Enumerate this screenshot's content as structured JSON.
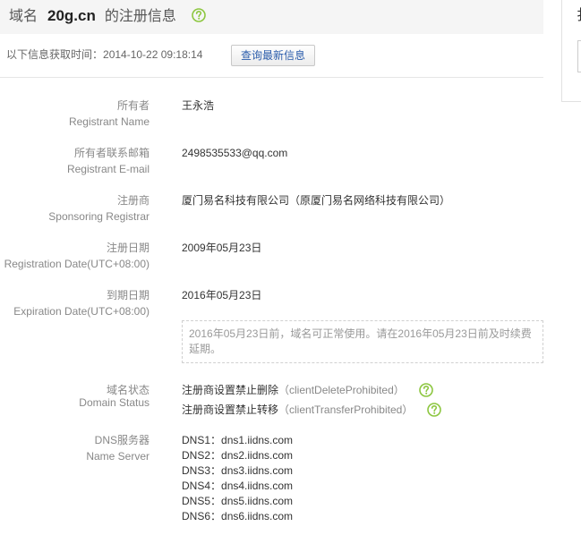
{
  "header": {
    "prefix": "域名",
    "domain": "20g.cn",
    "suffix": "的注册信息",
    "help_icon": "question-circle-icon"
  },
  "fetch_info": {
    "label": "以下信息获取时间：",
    "time": "2014-10-22 09:18:14",
    "refresh_button": "查询最新信息"
  },
  "side_panel": {
    "partial_glyph": "扌"
  },
  "registrant_name": {
    "label_cn": "所有者",
    "label_en": "Registrant Name",
    "value": "王永浩"
  },
  "registrant_email": {
    "label_cn": "所有者联系邮箱",
    "label_en": "Registrant E-mail",
    "value": "2498535533@qq.com"
  },
  "registrar": {
    "label_cn": "注册商",
    "label_en": "Sponsoring Registrar",
    "value": "厦门易名科技有限公司（原厦门易名网络科技有限公司）"
  },
  "registration_date": {
    "label_cn": "注册日期",
    "label_en": "Registration Date(UTC+08:00)",
    "value": "2009年05月23日"
  },
  "expiration_date": {
    "label_cn": "到期日期",
    "label_en": "Expiration Date(UTC+08:00)",
    "value": "2016年05月23日",
    "notice": "2016年05月23日前，域名可正常使用。请在2016年05月23日前及时续费延期。"
  },
  "domain_status": {
    "label_cn": "域名状态",
    "label_en": "Domain Status",
    "items": [
      {
        "text": "注册商设置禁止删除",
        "code": "（clientDeleteProhibited）",
        "help_icon": "question-circle-icon"
      },
      {
        "text": "注册商设置禁止转移",
        "code": "（clientTransferProhibited）",
        "help_icon": "question-circle-icon"
      }
    ]
  },
  "name_servers": {
    "label_cn": "DNS服务器",
    "label_en": "Name Server",
    "items": [
      {
        "label": "DNS1：",
        "value": "dns1.iidns.com"
      },
      {
        "label": "DNS2：",
        "value": "dns2.iidns.com"
      },
      {
        "label": "DNS3：",
        "value": "dns3.iidns.com"
      },
      {
        "label": "DNS4：",
        "value": "dns4.iidns.com"
      },
      {
        "label": "DNS5：",
        "value": "dns5.iidns.com"
      },
      {
        "label": "DNS6：",
        "value": "dns6.iidns.com"
      }
    ]
  },
  "colors": {
    "accent_green": "#8cc63f",
    "button_text": "#2a5cab",
    "header_background": "#f5f5f5",
    "label_text": "#888888",
    "value_text": "#333333",
    "notice_text": "#999999"
  }
}
